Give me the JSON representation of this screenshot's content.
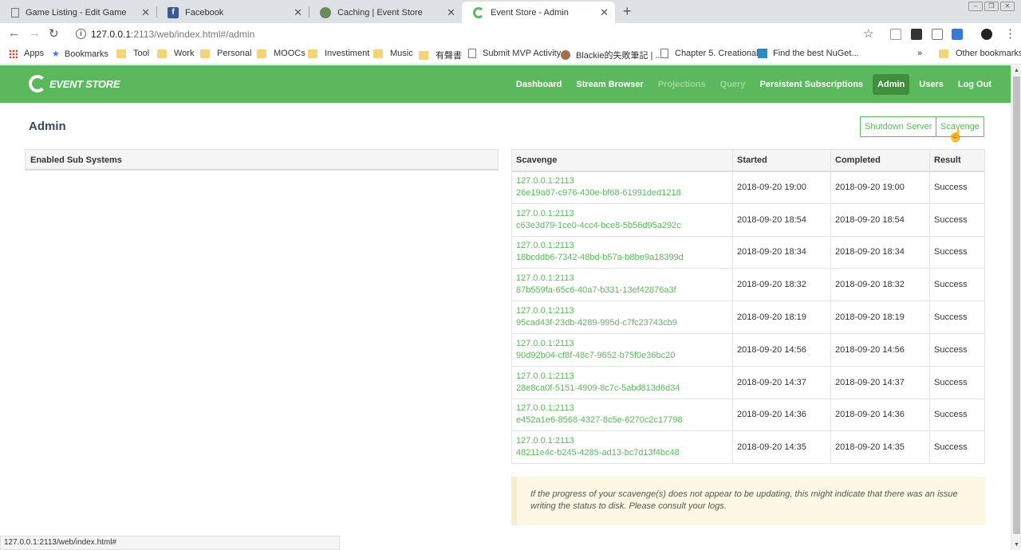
{
  "browser": {
    "tabs": [
      {
        "title": "Game Listing - Edit Game"
      },
      {
        "title": "Facebook"
      },
      {
        "title": "Caching | Event Store"
      },
      {
        "title": "Event Store - Admin"
      }
    ],
    "url_host": "127.0.0.1",
    "url_rest": ":2113/web/index.html#/admin",
    "bookmarks": [
      "Apps",
      "Bookmarks",
      "Tool",
      "Work",
      "Personal",
      "MOOCs",
      "Investiment",
      "Music",
      "有聲書",
      "Submit MVP Activity",
      "Blackie的失敗筆記 | ...",
      "Chapter 5. Creational...",
      "Find the best NuGet...",
      "Other bookmarks"
    ],
    "status_url": "127.0.0.1:2113/web/index.html#"
  },
  "app": {
    "logo": "EVENT STORE",
    "nav": [
      "Dashboard",
      "Stream Browser",
      "Projections",
      "Query",
      "Persistent Subscriptions",
      "Admin",
      "Users",
      "Log Out"
    ],
    "page_title": "Admin",
    "shutdown_label": "Shutdown Server",
    "scavenge_label": "Scavenge",
    "subsystems_header": "Enabled Sub Systems",
    "table": {
      "headers": [
        "Scavenge",
        "Started",
        "Completed",
        "Result"
      ],
      "rows": [
        {
          "host": "127.0.0.1:2113",
          "id": "26e19a87-c976-430e-bf68-61991ded1218",
          "started": "2018-09-20 19:00",
          "completed": "2018-09-20 19:00",
          "result": "Success"
        },
        {
          "host": "127.0.0.1:2113",
          "id": "c63e3d79-1ce0-4cc4-bce8-5b56d95a292c",
          "started": "2018-09-20 18:54",
          "completed": "2018-09-20 18:54",
          "result": "Success"
        },
        {
          "host": "127.0.0.1:2113",
          "id": "18bcddb6-7342-48bd-b57a-b8be9a18399d",
          "started": "2018-09-20 18:34",
          "completed": "2018-09-20 18:34",
          "result": "Success"
        },
        {
          "host": "127.0.0.1:2113",
          "id": "87b559fa-65c6-40a7-b331-13ef42876a3f",
          "started": "2018-09-20 18:32",
          "completed": "2018-09-20 18:32",
          "result": "Success"
        },
        {
          "host": "127.0.0.1:2113",
          "id": "95cad43f-23db-4289-995d-c7fc23743cb9",
          "started": "2018-09-20 18:19",
          "completed": "2018-09-20 18:19",
          "result": "Success"
        },
        {
          "host": "127.0.0.1:2113",
          "id": "90d92b04-cf8f-48c7-9652-b75f0e36bc20",
          "started": "2018-09-20 14:56",
          "completed": "2018-09-20 14:56",
          "result": "Success"
        },
        {
          "host": "127.0.0.1:2113",
          "id": "28e8ca0f-5151-4909-8c7c-5abd813d6d34",
          "started": "2018-09-20 14:37",
          "completed": "2018-09-20 14:37",
          "result": "Success"
        },
        {
          "host": "127.0.0.1:2113",
          "id": "e452a1e6-8568-4327-8c5e-6270c2c17798",
          "started": "2018-09-20 14:36",
          "completed": "2018-09-20 14:36",
          "result": "Success"
        },
        {
          "host": "127.0.0.1:2113",
          "id": "48211e4c-b245-4285-ad13-bc7d13f4bc48",
          "started": "2018-09-20 14:35",
          "completed": "2018-09-20 14:35",
          "result": "Success"
        }
      ]
    },
    "notice": "If the progress of your scavenge(s) does not appear to be updating, this might indicate that there was an issue writing the status to disk. Please consult your logs."
  },
  "colors": {
    "brand": "#5cb85c",
    "nav_active": "#3e8e3e",
    "notice_bg": "#fcf8e3"
  }
}
